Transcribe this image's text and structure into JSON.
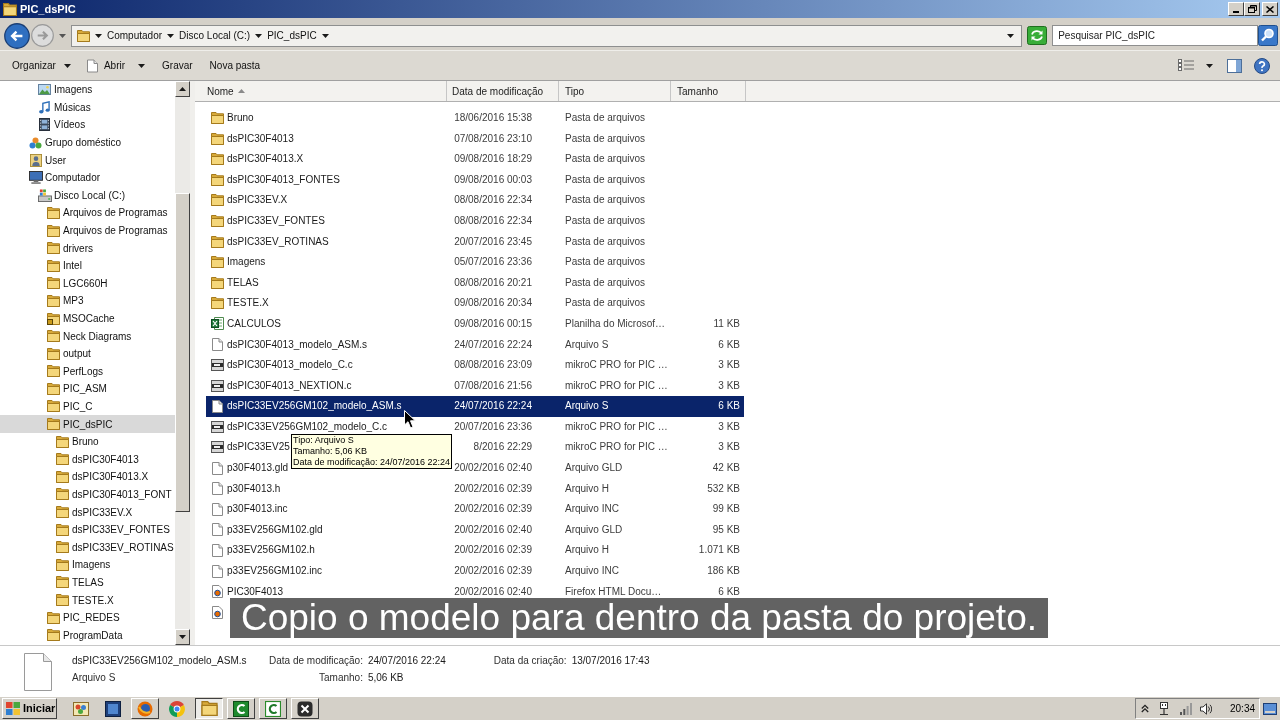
{
  "window": {
    "title": "PIC_dsPIC"
  },
  "navigation": {
    "back": {
      "disabled": false
    },
    "forward": {
      "disabled": true
    }
  },
  "address_bar": {
    "crumbs": [
      "Computador",
      "Disco Local (C:)",
      "PIC_dsPIC"
    ]
  },
  "search": {
    "placeholder": "Pesquisar PIC_dsPIC"
  },
  "command_bar": {
    "items": [
      {
        "label": "Organizar",
        "kind": "dropdown"
      },
      {
        "label": "Abrir",
        "kind": "open"
      },
      {
        "label": "Gravar",
        "kind": "plain"
      },
      {
        "label": "Nova pasta",
        "kind": "plain"
      }
    ]
  },
  "nav_tree": {
    "items": [
      {
        "children": [
          {
            "label": "Imagens",
            "kind": "pictures",
            "selected": false
          },
          {
            "label": "Músicas",
            "kind": "music",
            "selected": false
          },
          {
            "label": "Vídeos",
            "kind": "video",
            "selected": false
          }
        ]
      },
      {
        "label": "Grupo doméstico",
        "kind": "homegroup",
        "selected": false
      },
      {
        "label": "User",
        "kind": "user",
        "selected": false
      },
      {
        "label": "Computador",
        "kind": "computer",
        "selected": false,
        "children": [
          {
            "label": "Disco Local (C:)",
            "kind": "drive",
            "selected": false,
            "children": [
              {
                "label": "Arquivos de Programas",
                "kind": "folder",
                "selected": false
              },
              {
                "label": "Arquivos de Programas",
                "kind": "folder",
                "selected": false
              },
              {
                "label": "drivers",
                "kind": "folder",
                "selected": false
              },
              {
                "label": "Intel",
                "kind": "folder",
                "selected": false
              },
              {
                "label": "LGC660H",
                "kind": "folder",
                "selected": false
              },
              {
                "label": "MP3",
                "kind": "folder",
                "selected": false
              },
              {
                "label": "MSOCache",
                "kind": "folder-locked",
                "selected": false
              },
              {
                "label": "Neck Diagrams",
                "kind": "folder",
                "selected": false
              },
              {
                "label": "output",
                "kind": "folder",
                "selected": false
              },
              {
                "label": "PerfLogs",
                "kind": "folder",
                "selected": false
              },
              {
                "label": "PIC_ASM",
                "kind": "folder",
                "selected": false
              },
              {
                "label": "PIC_C",
                "kind": "folder",
                "selected": false
              },
              {
                "label": "PIC_dsPIC",
                "kind": "folder",
                "selected": true,
                "children": [
                  {
                    "label": "Bruno",
                    "kind": "folder",
                    "selected": false
                  },
                  {
                    "label": "dsPIC30F4013",
                    "kind": "folder",
                    "selected": false
                  },
                  {
                    "label": "dsPIC30F4013.X",
                    "kind": "folder",
                    "selected": false
                  },
                  {
                    "label": "dsPIC30F4013_FONT",
                    "kind": "folder",
                    "selected": false
                  },
                  {
                    "label": "dsPIC33EV.X",
                    "kind": "folder",
                    "selected": false
                  },
                  {
                    "label": "dsPIC33EV_FONTES",
                    "kind": "folder",
                    "selected": false
                  },
                  {
                    "label": "dsPIC33EV_ROTINAS",
                    "kind": "folder",
                    "selected": false
                  },
                  {
                    "label": "Imagens",
                    "kind": "folder",
                    "selected": false
                  },
                  {
                    "label": "TELAS",
                    "kind": "folder",
                    "selected": false
                  },
                  {
                    "label": "TESTE.X",
                    "kind": "folder",
                    "selected": false
                  }
                ]
              },
              {
                "label": "PIC_REDES",
                "kind": "folder",
                "selected": false
              },
              {
                "label": "ProgramData",
                "kind": "folder",
                "selected": false
              }
            ]
          }
        ]
      }
    ]
  },
  "file_list": {
    "columns": [
      {
        "label": "Nome",
        "sorted": true
      },
      {
        "label": "Data de modificação",
        "sorted": false
      },
      {
        "label": "Tipo",
        "sorted": false
      },
      {
        "label": "Tamanho",
        "sorted": false
      }
    ],
    "rows": [
      {
        "kind": "folder",
        "name": "Bruno",
        "date": "18/06/2016 15:38",
        "type": "Pasta de arquivos",
        "selected": false
      },
      {
        "kind": "folder",
        "name": "dsPIC30F4013",
        "date": "07/08/2016 23:10",
        "type": "Pasta de arquivos",
        "selected": false
      },
      {
        "kind": "folder",
        "name": "dsPIC30F4013.X",
        "date": "09/08/2016 18:29",
        "type": "Pasta de arquivos",
        "selected": false
      },
      {
        "kind": "folder",
        "name": "dsPIC30F4013_FONTES",
        "date": "09/08/2016 00:03",
        "type": "Pasta de arquivos",
        "selected": false
      },
      {
        "kind": "folder",
        "name": "dsPIC33EV.X",
        "date": "08/08/2016 22:34",
        "type": "Pasta de arquivos",
        "selected": false
      },
      {
        "kind": "folder",
        "name": "dsPIC33EV_FONTES",
        "date": "08/08/2016 22:34",
        "type": "Pasta de arquivos",
        "selected": false
      },
      {
        "kind": "folder",
        "name": "dsPIC33EV_ROTINAS",
        "date": "20/07/2016 23:45",
        "type": "Pasta de arquivos",
        "selected": false
      },
      {
        "kind": "folder",
        "name": "Imagens",
        "date": "05/07/2016 23:36",
        "type": "Pasta de arquivos",
        "selected": false
      },
      {
        "kind": "folder",
        "name": "TELAS",
        "date": "08/08/2016 20:21",
        "type": "Pasta de arquivos",
        "selected": false
      },
      {
        "kind": "folder",
        "name": "TESTE.X",
        "date": "09/08/2016 20:34",
        "type": "Pasta de arquivos",
        "selected": false
      },
      {
        "kind": "spreadsheet",
        "name": "CALCULOS",
        "date": "09/08/2016 00:15",
        "type": "Planilha do Microsof…",
        "size": "11 KB",
        "selected": false
      },
      {
        "kind": "text",
        "name": "dsPIC30F4013_modelo_ASM.s",
        "date": "24/07/2016 22:24",
        "type": "Arquivo S",
        "size": "6 KB",
        "selected": false
      },
      {
        "kind": "source",
        "name": "dsPIC30F4013_modelo_C.c",
        "date": "08/08/2016 23:09",
        "type": "mikroC PRO for PIC …",
        "size": "3 KB",
        "selected": false
      },
      {
        "kind": "source",
        "name": "dsPIC30F4013_NEXTION.c",
        "date": "07/08/2016 21:56",
        "type": "mikroC PRO for PIC …",
        "size": "3 KB",
        "selected": false
      },
      {
        "kind": "text",
        "name": "dsPIC33EV256GM102_modelo_ASM.s",
        "date": "24/07/2016 22:24",
        "type": "Arquivo S",
        "size": "6 KB",
        "selected": true
      },
      {
        "kind": "source",
        "name": "dsPIC33EV256GM102_modelo_C.c",
        "date": "20/07/2016 23:36",
        "type": "mikroC PRO for PIC …",
        "size": "3 KB",
        "selected": false
      },
      {
        "kind": "source",
        "name": "dsPIC33EV25",
        "date": "8/2016 22:29",
        "type": "mikroC PRO for PIC …",
        "size": "3 KB",
        "selected": false
      },
      {
        "kind": "text",
        "name": "p30F4013.gld",
        "date": "20/02/2016 02:40",
        "type": "Arquivo GLD",
        "size": "42 KB",
        "selected": false
      },
      {
        "kind": "text",
        "name": "p30F4013.h",
        "date": "20/02/2016 02:39",
        "type": "Arquivo H",
        "size": "532 KB",
        "selected": false
      },
      {
        "kind": "text",
        "name": "p30F4013.inc",
        "date": "20/02/2016 02:39",
        "type": "Arquivo INC",
        "size": "99 KB",
        "selected": false
      },
      {
        "kind": "text",
        "name": "p33EV256GM102.gld",
        "date": "20/02/2016 02:40",
        "type": "Arquivo GLD",
        "size": "95 KB",
        "selected": false
      },
      {
        "kind": "text",
        "name": "p33EV256GM102.h",
        "date": "20/02/2016 02:39",
        "type": "Arquivo H",
        "size": "1.071 KB",
        "selected": false
      },
      {
        "kind": "text",
        "name": "p33EV256GM102.inc",
        "date": "20/02/2016 02:39",
        "type": "Arquivo INC",
        "size": "186 KB",
        "selected": false
      },
      {
        "kind": "web",
        "name": "PIC30F4013",
        "date": "20/02/2016 02:40",
        "type": "Firefox HTML Docu…",
        "size": "6 KB",
        "selected": false
      },
      {
        "kind": "web",
        "selected": false
      }
    ]
  },
  "tooltip": {
    "lines": [
      "Tipo: Arquivo S",
      "Tamanho: 5,06 KB",
      "Data de modificação: 24/07/2016 22:24"
    ]
  },
  "details": {
    "name": "dsPIC33EV256GM102_modelo_ASM.s",
    "type": "Arquivo S",
    "fields": [
      {
        "label": "Data de modificação:",
        "value": "24/07/2016 22:24"
      },
      {
        "label": "Tamanho:",
        "value": "5,06 KB"
      },
      {
        "label": "Data da criação:",
        "value": "13/07/2016 17:43"
      }
    ]
  },
  "caption": {
    "text": "Copio o modelo para dentro da pasta do projeto."
  },
  "taskbar": {
    "start": {
      "label": "Iniciar"
    },
    "apps": [
      {
        "kind": "gallery",
        "running": false,
        "selected": false
      },
      {
        "kind": "screen",
        "running": false,
        "selected": false
      },
      {
        "kind": "firefox",
        "running": true,
        "selected": false
      },
      {
        "kind": "chrome",
        "running": false,
        "selected": false
      },
      {
        "kind": "explorer",
        "running": true,
        "selected": true
      },
      {
        "kind": "c-solid",
        "running": true,
        "selected": false
      },
      {
        "kind": "c-outline",
        "running": true,
        "selected": false
      },
      {
        "kind": "x-circle",
        "running": true,
        "selected": false
      }
    ],
    "clock": "20:34"
  }
}
